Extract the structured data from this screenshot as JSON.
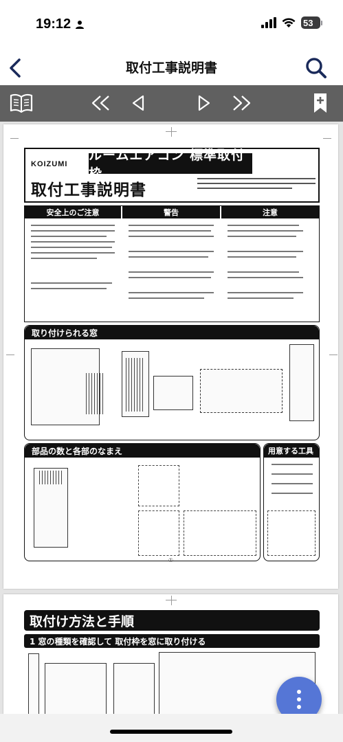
{
  "status_bar": {
    "time": "19:12",
    "battery": "53",
    "icons": [
      "person-icon",
      "signal-icon",
      "wifi-icon",
      "battery-icon"
    ]
  },
  "nav": {
    "title": "取付工事説明書",
    "back_icon": "chevron-left-icon",
    "search_icon": "search-icon"
  },
  "toolbar": {
    "icons": [
      "book-icon",
      "rewind-icon",
      "previous-icon",
      "next-icon",
      "fast-forward-icon",
      "bookmark-add-icon"
    ],
    "bg": "#606060"
  },
  "document": {
    "page1": {
      "brand": "KOIZUMI",
      "product": "ルームエアコン 標準取付枠",
      "title": "取付工事説明書",
      "safety_sections": [
        "安全上のご注意",
        "警告",
        "注意"
      ],
      "section_install_window": "取り付けられる窓",
      "section_parts": "部品の数と各部のなまえ",
      "section_tools": "用意する工具",
      "page_number": "①"
    },
    "page2": {
      "title": "取付け方法と手順",
      "step1": "1 窓の種類を確認して 取付枠を窓に取り付ける"
    }
  },
  "fab": {
    "icon": "more-vertical-icon",
    "color": "#5576d6"
  }
}
